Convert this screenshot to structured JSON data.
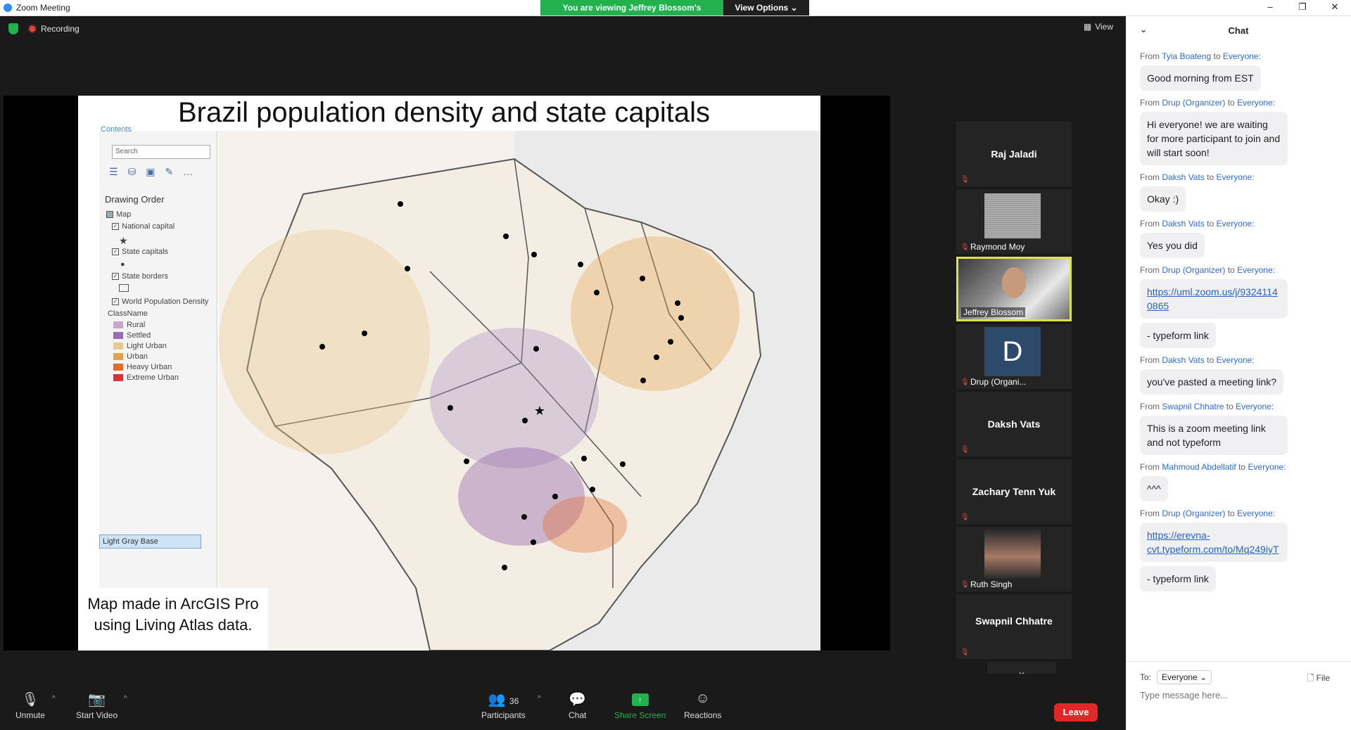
{
  "window": {
    "title": "Zoom Meeting",
    "controls": [
      "–",
      "❐",
      "✕"
    ]
  },
  "banner": {
    "viewing_text": "You are viewing Jeffrey Blossom's screen",
    "view_options_label": "View Options ⌄"
  },
  "status": {
    "recording_label": "Recording",
    "view_label": "View"
  },
  "slide": {
    "title": "Brazil population density and state capitals",
    "caption": "Map made in ArcGIS Pro using Living Atlas data.",
    "arcgis": {
      "contents_label": "Contents",
      "search_placeholder": "Search",
      "drawing_order_label": "Drawing Order",
      "map_label": "Map",
      "layers": [
        "National capital",
        "State capitals",
        "State borders",
        "World Population Density"
      ],
      "classname_label": "ClassName",
      "classes": [
        {
          "name": "Rural",
          "color": "#c9a6c9"
        },
        {
          "name": "Settled",
          "color": "#9a6fb0"
        },
        {
          "name": "Light Urban",
          "color": "#e8c98d"
        },
        {
          "name": "Urban",
          "color": "#e4a14a"
        },
        {
          "name": "Heavy Urban",
          "color": "#e36b2c"
        },
        {
          "name": "Extreme Urban",
          "color": "#d8313c"
        }
      ],
      "basemap_label": "Light Gray Base"
    }
  },
  "gallery": [
    {
      "name": "Raj Jaladi",
      "muted": true,
      "video": false
    },
    {
      "name": "Raymond Moy",
      "muted": true,
      "video": true
    },
    {
      "name": "Jeffrey Blossom",
      "muted": false,
      "video": true,
      "active": true
    },
    {
      "name": "Drup (Organi...",
      "muted": true,
      "video": true,
      "avatar_letter": "D"
    },
    {
      "name": "Daksh Vats",
      "muted": true,
      "video": false
    },
    {
      "name": "Zachary Tenn Yuk",
      "muted": true,
      "video": false
    },
    {
      "name": "Ruth Singh",
      "muted": true,
      "video": true
    },
    {
      "name": "Swapnil Chhatre",
      "muted": true,
      "video": false
    }
  ],
  "chat": {
    "title": "Chat",
    "messages": [
      {
        "from": "Tyia Boateng",
        "to": "Everyone:",
        "text": "Good morning from EST"
      },
      {
        "from": "Drup (Organizer)",
        "to": "Everyone:",
        "text": "Hi everyone! we are waiting for more participant to join and will start soon!"
      },
      {
        "from": "Daksh Vats",
        "to": "Everyone:",
        "text": "Okay :)"
      },
      {
        "from": "Daksh Vats",
        "to": "Everyone:",
        "text": "Yes you did"
      },
      {
        "from": "Drup (Organizer)",
        "to": "Everyone:",
        "text": "https://uml.zoom.us/j/93241140865",
        "link": true
      },
      {
        "from": "",
        "to": "",
        "text": "- typeform link"
      },
      {
        "from": "Daksh Vats",
        "to": "Everyone:",
        "text": "you've pasted a meeting link?"
      },
      {
        "from": "Swapnil Chhatre",
        "to": "Everyone:",
        "text": "This is a zoom meeting link and not typeform"
      },
      {
        "from": "Mahmoud Abdellatif",
        "to": "Everyone:",
        "text": "^^^"
      },
      {
        "from": "Drup (Organizer)",
        "to": "Everyone:",
        "text": "https://erevna-cvt.typeform.com/to/Mq249iyT",
        "link": true
      },
      {
        "from": "",
        "to": "",
        "text": "- typeform link"
      }
    ],
    "from_word": "From",
    "to_word": "to",
    "to_label": "To:",
    "recipient": "Everyone",
    "file_label": "File",
    "input_placeholder": "Type message here..."
  },
  "toolbar": {
    "unmute": "Unmute",
    "start_video": "Start Video",
    "participants": "Participants",
    "participant_count": "36",
    "chat": "Chat",
    "share_screen": "Share Screen",
    "reactions": "Reactions",
    "leave": "Leave"
  }
}
